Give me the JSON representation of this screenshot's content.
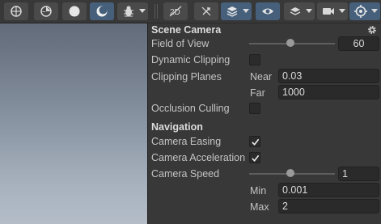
{
  "toolbar": {
    "buttons": [
      {
        "name": "shaded-mode-icon"
      },
      {
        "name": "wireframe-sphere-icon"
      },
      {
        "name": "solid-sphere-icon"
      },
      {
        "name": "lit-sphere-icon"
      },
      {
        "name": "gizmo-bug-icon"
      },
      {
        "name": "audio-off-icon"
      },
      {
        "name": "fx-icon"
      },
      {
        "name": "layers-icon"
      },
      {
        "name": "visibility-eye-icon"
      },
      {
        "name": "stack-icon"
      },
      {
        "name": "camera-icon"
      },
      {
        "name": "orientation-gizmo-icon"
      }
    ]
  },
  "scene_camera": {
    "header": "Scene Camera",
    "field_of_view": {
      "label": "Field of View",
      "value": "60",
      "slider_fraction": 0.48
    },
    "dynamic_clipping": {
      "label": "Dynamic Clipping",
      "checked": false
    },
    "clipping_planes": {
      "label": "Clipping Planes",
      "near": {
        "label": "Near",
        "value": "0.03"
      },
      "far": {
        "label": "Far",
        "value": "1000"
      }
    },
    "occlusion_culling": {
      "label": "Occlusion Culling",
      "checked": false
    }
  },
  "navigation": {
    "header": "Navigation",
    "camera_easing": {
      "label": "Camera Easing",
      "checked": true
    },
    "camera_acceleration": {
      "label": "Camera Acceleration",
      "checked": true
    },
    "camera_speed": {
      "label": "Camera Speed",
      "value": "1",
      "slider_fraction": 0.48,
      "min": {
        "label": "Min",
        "value": "0.001"
      },
      "max": {
        "label": "Max",
        "value": "2"
      }
    }
  },
  "colors": {
    "accent": "#46607c",
    "panel_bg": "#383838",
    "field_bg": "#2a2a2a"
  }
}
